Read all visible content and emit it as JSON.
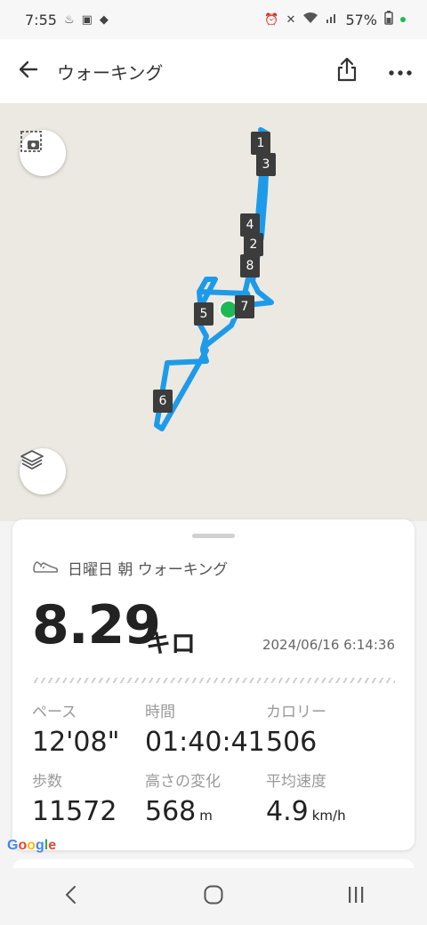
{
  "status_bar": {
    "time": "7:55",
    "battery": "57%"
  },
  "app_bar": {
    "title": "ウォーキング"
  },
  "map": {
    "route_color": "#1e9be8",
    "markers": [
      "1",
      "3",
      "4",
      "2",
      "8",
      "5",
      "7",
      "6"
    ]
  },
  "card": {
    "activity_label": "日曜日 朝 ウォーキング",
    "distance": "8.29",
    "distance_unit": "キロ",
    "datetime": "2024/06/16 6:14:36",
    "stats": [
      {
        "label": "ペース",
        "value": "12'08\"",
        "unit": ""
      },
      {
        "label": "時間",
        "value": "01:40:41",
        "unit": ""
      },
      {
        "label": "カロリー",
        "value": "506",
        "unit": ""
      },
      {
        "label": "歩数",
        "value": "11572",
        "unit": ""
      },
      {
        "label": "高さの変化",
        "value": "568",
        "unit": "m"
      },
      {
        "label": "平均速度",
        "value": "4.9",
        "unit": "km/h"
      }
    ]
  },
  "google_logo": "Google",
  "icons": {
    "back": "arrow-left-icon",
    "share": "share-icon",
    "more": "more-horizontal-icon",
    "snapshot": "camera-snapshot-icon",
    "layers": "layers-icon",
    "shoe": "shoe-icon"
  }
}
